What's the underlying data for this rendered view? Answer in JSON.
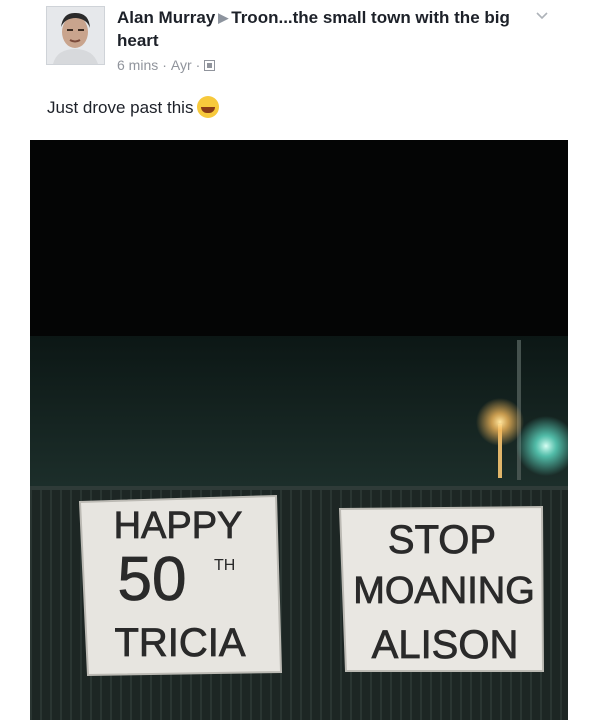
{
  "post": {
    "author": "Alan Murray",
    "group": "Troon...the small town with the big heart",
    "time": "6 mins",
    "location": "Ayr",
    "privacy_icon": "group-privacy-icon",
    "text": "Just drove past this",
    "emoji": "laughing-crying-emoji",
    "menu_icon": "chevron-down-icon"
  },
  "photo": {
    "banner_left": [
      "HAPPY",
      "50",
      "TH",
      "TRICIA"
    ],
    "banner_right": [
      "STOP",
      "MOANING",
      "ALISON"
    ]
  }
}
